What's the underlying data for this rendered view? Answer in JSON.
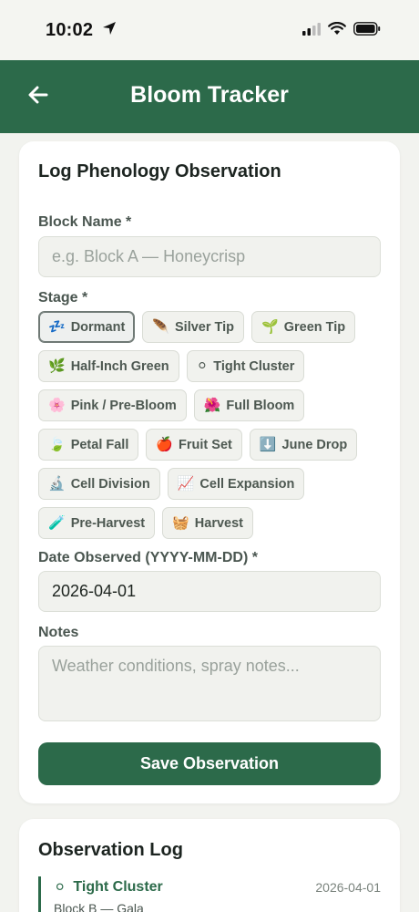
{
  "status_bar": {
    "time": "10:02"
  },
  "header": {
    "title": "Bloom Tracker"
  },
  "form": {
    "title": "Log Phenology Observation",
    "block_name_label": "Block Name *",
    "block_name_placeholder": "e.g. Block A — Honeycrisp",
    "block_name_value": "",
    "stage_label": "Stage *",
    "stages": [
      {
        "emoji": "💤",
        "label": "Dormant",
        "selected": true
      },
      {
        "emoji": "🪶",
        "label": "Silver Tip",
        "selected": false
      },
      {
        "emoji": "🌱",
        "label": "Green Tip",
        "selected": false
      },
      {
        "emoji": "🌿",
        "label": "Half-Inch Green",
        "selected": false
      },
      {
        "emoji": "⚪",
        "label": "Tight Cluster",
        "selected": false
      },
      {
        "emoji": "🌸",
        "label": "Pink / Pre-Bloom",
        "selected": false
      },
      {
        "emoji": "🌺",
        "label": "Full Bloom",
        "selected": false
      },
      {
        "emoji": "🍃",
        "label": "Petal Fall",
        "selected": false
      },
      {
        "emoji": "🍎",
        "label": "Fruit Set",
        "selected": false
      },
      {
        "emoji": "⬇️",
        "label": "June Drop",
        "selected": false
      },
      {
        "emoji": "🔬",
        "label": "Cell Division",
        "selected": false
      },
      {
        "emoji": "📈",
        "label": "Cell Expansion",
        "selected": false
      },
      {
        "emoji": "🧪",
        "label": "Pre-Harvest",
        "selected": false
      },
      {
        "emoji": "🧺",
        "label": "Harvest",
        "selected": false
      }
    ],
    "date_label": "Date Observed (YYYY-MM-DD) *",
    "date_value": "2026-04-01",
    "notes_label": "Notes",
    "notes_placeholder": "Weather conditions, spray notes...",
    "notes_value": "",
    "save_label": "Save Observation"
  },
  "log": {
    "title": "Observation Log",
    "entries": [
      {
        "emoji": "⚪",
        "stage": "Tight Cluster",
        "date": "2026-04-01",
        "block": "Block B — Gala"
      }
    ]
  }
}
